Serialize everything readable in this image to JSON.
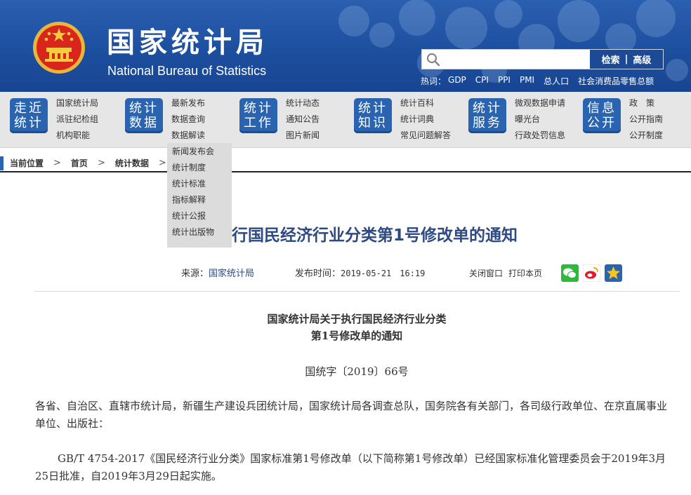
{
  "header": {
    "site_title": "国家统计局",
    "site_subtitle": "National Bureau of Statistics",
    "search": {
      "placeholder": "",
      "search_label": "检索",
      "advanced_label": "高级"
    },
    "hot_label": "热词：",
    "hot_words": [
      "GDP",
      "CPI",
      "PPI",
      "PMI",
      "总人口",
      "社会消费品零售总额"
    ],
    "colors": {
      "header_bg": "#1d4f9f",
      "accent": "#2a64b0"
    }
  },
  "nav": {
    "groups": [
      {
        "badge": "走近统计",
        "links": [
          "国家统计局",
          "派驻纪检组",
          "机构职能"
        ]
      },
      {
        "badge": "统计数据",
        "links": [
          "最新发布",
          "数据查询",
          "数据解读"
        ]
      },
      {
        "badge": "统计工作",
        "links": [
          "统计动态",
          "通知公告",
          "图片新闻"
        ]
      },
      {
        "badge": "统计知识",
        "links": [
          "统计百科",
          "统计词典",
          "常见问题解答"
        ]
      },
      {
        "badge": "统计服务",
        "links": [
          "微观数据申请",
          "曝光台",
          "行政处罚信息"
        ]
      },
      {
        "badge": "信息公开",
        "links": [
          "政　策",
          "公开指南",
          "公开制度"
        ]
      }
    ],
    "dropdown": [
      "新闻发布会",
      "统计制度",
      "统计标准",
      "指标解释",
      "统计公报",
      "统计出版物"
    ]
  },
  "breadcrumb": {
    "items": [
      "当前位置",
      "首页",
      "统计数据"
    ]
  },
  "article": {
    "title_visible": "行国民经济行业分类第1号修改单的通知",
    "source_label": "来源：",
    "source": "国家统计局",
    "time_label": "发布时间：",
    "time": "2019-05-21　16:19",
    "close_label": "关闭窗口",
    "print_label": "打印本页",
    "share_icons": [
      "wechat-icon",
      "weibo-icon",
      "favorite-star-icon"
    ],
    "heading_line1": "国家统计局关于执行国民经济行业分类",
    "heading_line2": "第1号修改单的通知",
    "doc_number": "国统字〔2019〕66号",
    "paragraph1": "各省、自治区、直辖市统计局，新疆生产建设兵团统计局，国家统计局各调查总队，国务院各有关部门，各司级行政单位、在京直属事业单位、出版社：",
    "paragraph2": "GB/T 4754-2017《国民经济行业分类》国家标准第1号修改单（以下简称第1号修改单）已经国家标准化管理委员会于2019年3月25日批准，自2019年3月29日起实施。"
  }
}
